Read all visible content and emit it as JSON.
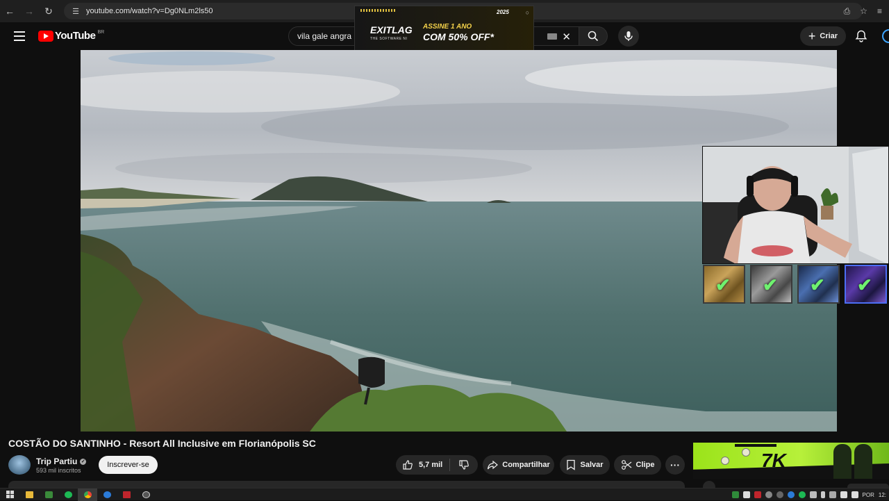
{
  "browser": {
    "url": "youtube.com/watch?v=Dg0NLm2ls50"
  },
  "header": {
    "logo_text": "YouTube",
    "region": "BR",
    "search_query": "vila gale angra",
    "create_label": "Criar"
  },
  "ad_banner": {
    "logo": "EXITLAG",
    "tagline": "THE SOFTWARE NI",
    "line1": "ASSINE 1 ANO",
    "line2": "COM 50% OFF*",
    "badge": "2025"
  },
  "video": {
    "title": "COSTÃO DO SANTINHO - Resort All Inclusive em Florianópolis SC"
  },
  "channel": {
    "name": "Trip Partiu",
    "subscribers": "593 mil inscritos",
    "subscribe_label": "Inscrever-se"
  },
  "actions": {
    "likes": "5,7 mil",
    "share": "Compartilhar",
    "save": "Salvar",
    "clip": "Clipe",
    "more": "···"
  },
  "side_ad": {
    "brand": "7K"
  },
  "taskbar": {
    "lang": "POR",
    "clock": "12:"
  },
  "colors": {
    "yt_red": "#ff0000",
    "background": "#0f0f0f",
    "pill": "#272727",
    "ad_green": "#9be31a",
    "check_green": "#6ff26f"
  }
}
